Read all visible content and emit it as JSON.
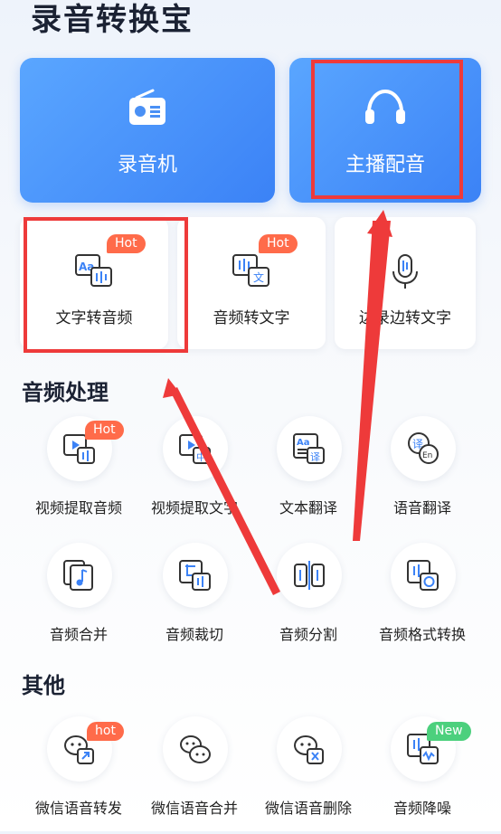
{
  "app_title": "录音转换宝",
  "top_cards": {
    "recorder": "录音机",
    "anchor_dub": "主播配音"
  },
  "feature_cards": {
    "text_to_audio": "文字转音频",
    "audio_to_text": "音频转文字",
    "record_transcribe": "边录边转文字"
  },
  "audio_section": {
    "title": "音频处理",
    "items": [
      "视频提取音频",
      "视频提取文字",
      "文本翻译",
      "语音翻译",
      "音频合并",
      "音频裁切",
      "音频分割",
      "音频格式转换"
    ]
  },
  "other_section": {
    "title": "其他",
    "items": [
      "微信语音转发",
      "微信语音合并",
      "微信语音删除",
      "音频降噪"
    ]
  },
  "badges": {
    "hot": "Hot",
    "hot_lower": "hot",
    "new": "New"
  },
  "colors": {
    "accent_blue": "#3b82f6",
    "hot_badge": "#ff6b4a",
    "new_badge": "#4cd07d",
    "annotation_red": "#ee3a3a"
  }
}
